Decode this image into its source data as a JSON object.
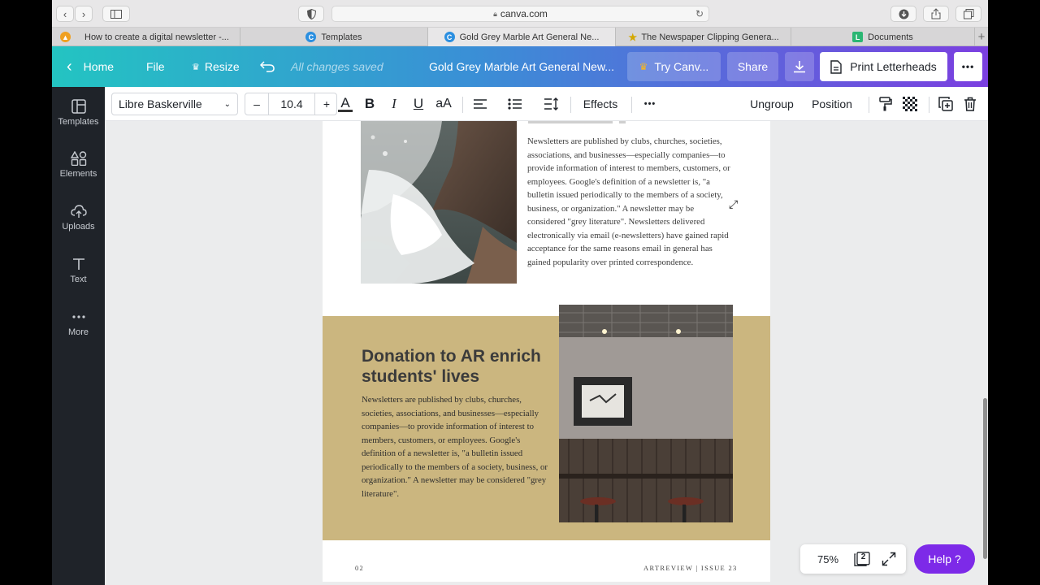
{
  "browser": {
    "url": "canva.com",
    "tabs": [
      {
        "label": "How to create a digital newsletter -...",
        "color": "#f0a020",
        "glyph": "▲"
      },
      {
        "label": "Templates",
        "color": "#2b8fe0",
        "glyph": "C"
      },
      {
        "label": "Gold Grey Marble Art General Ne...",
        "color": "#2b8fe0",
        "glyph": "C"
      },
      {
        "label": "The Newspaper Clipping Genera...",
        "color": "#e6c200",
        "glyph": "★"
      },
      {
        "label": "Documents",
        "color": "#2bb673",
        "glyph": "L"
      }
    ]
  },
  "header": {
    "home": "Home",
    "file": "File",
    "resize": "Resize",
    "saved": "All changes saved",
    "doc_title": "Gold Grey Marble Art General New...",
    "try": "Try Canv...",
    "share": "Share",
    "print": "Print Letterheads",
    "more": "•••"
  },
  "sidebar": {
    "items": [
      {
        "label": "Templates"
      },
      {
        "label": "Elements"
      },
      {
        "label": "Uploads"
      },
      {
        "label": "Text"
      },
      {
        "label": "More"
      }
    ]
  },
  "toolbar": {
    "font": "Libre Baskerville",
    "minus": "–",
    "size": "10.4",
    "plus": "+",
    "text_color": "A",
    "bold": "B",
    "italic": "I",
    "underline": "U",
    "case": "aA",
    "effects": "Effects",
    "more": "•••",
    "ungroup": "Ungroup",
    "position": "Position"
  },
  "document": {
    "paragraph1": "Newsletters are published by clubs, churches, societies, associations, and businesses—especially companies—to provide information of interest to members, customers, or employees. Google's definition of a newsletter is, \"a bulletin issued periodically to the members of a society, business, or organization.\" A newsletter may be considered \"grey literature\". Newsletters delivered electronically via email (e-newsletters) have gained rapid acceptance for the same reasons email in general has gained popularity over printed correspondence.",
    "headline": "Donation to AR enrich students' lives",
    "paragraph2": "Newsletters are published by clubs, churches, societies, associations, and businesses—especially companies—to provide information of interest to members, customers, or employees. Google's definition of a newsletter is, \"a bulletin issued periodically to the members of a society, business, or organization.\" A newsletter may be considered \"grey literature\".",
    "page_number": "02",
    "issue": "ARTREVIEW | ISSUE 23"
  },
  "bottom": {
    "zoom": "75%",
    "pages": "2",
    "help": "Help ?"
  }
}
